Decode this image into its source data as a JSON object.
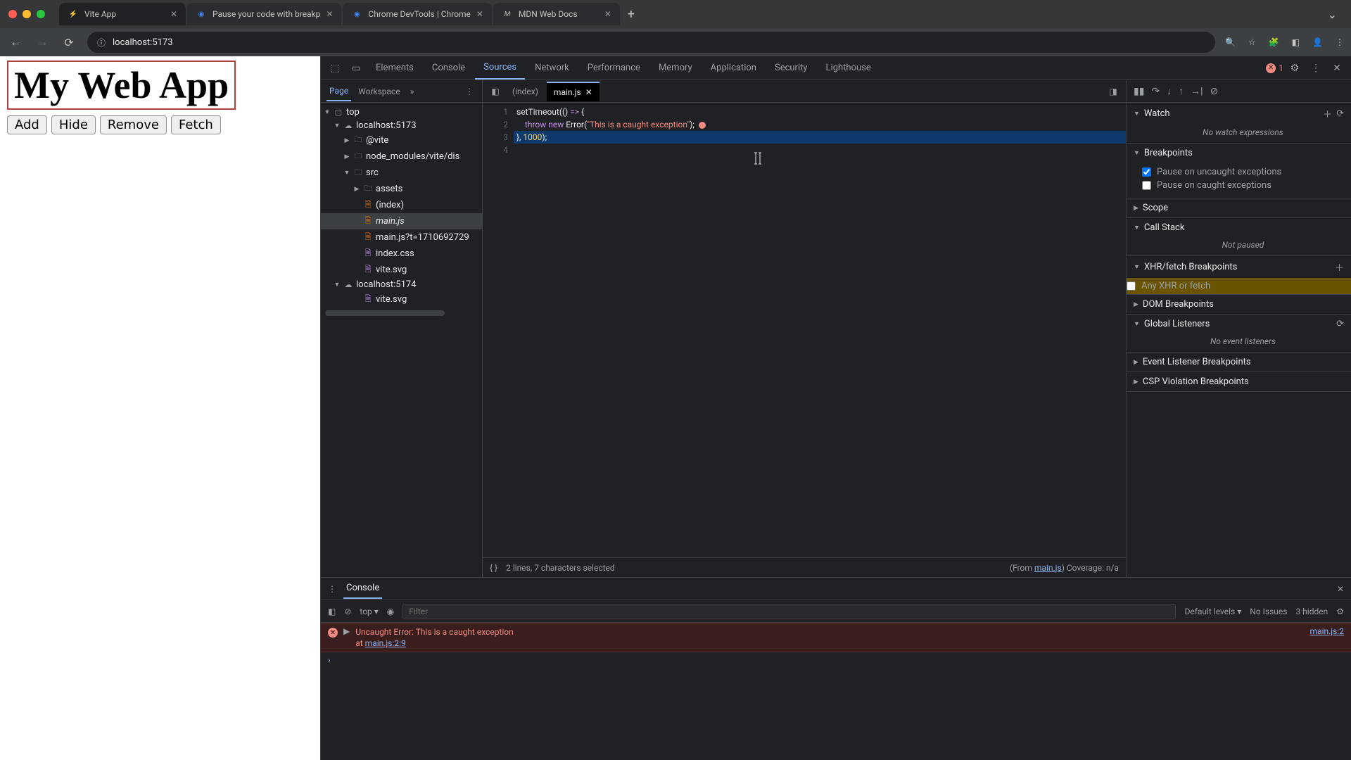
{
  "browser": {
    "tabs": [
      {
        "title": "Vite App",
        "favicon": "⚡"
      },
      {
        "title": "Pause your code with breakp",
        "favicon": "◉"
      },
      {
        "title": "Chrome DevTools  |  Chrome",
        "favicon": "◉"
      },
      {
        "title": "MDN Web Docs",
        "favicon": "M"
      }
    ],
    "url": "localhost:5173"
  },
  "page": {
    "heading": "My Web App",
    "buttons": [
      "Add",
      "Hide",
      "Remove",
      "Fetch"
    ]
  },
  "devtools": {
    "panels": [
      "Elements",
      "Console",
      "Sources",
      "Network",
      "Performance",
      "Memory",
      "Application",
      "Security",
      "Lighthouse"
    ],
    "active_panel": "Sources",
    "error_count": "1"
  },
  "nav": {
    "tabs": {
      "page": "Page",
      "workspace": "Workspace"
    },
    "tree": {
      "top": "top",
      "host1": "localhost:5173",
      "vite": "@vite",
      "node_modules": "node_modules/vite/dis",
      "src": "src",
      "assets": "assets",
      "index": "(index)",
      "mainjs": "main.js",
      "mainjs_q": "main.js?t=1710692729",
      "indexcss": "index.css",
      "vitesvg": "vite.svg",
      "host2": "localhost:5174",
      "vitesvg2": "vite.svg"
    }
  },
  "editor": {
    "tabs": {
      "index": "(index)",
      "main": "main.js"
    },
    "code": {
      "l1_a": "setTimeout",
      "l1_b": "(() ",
      "l1_c": "=>",
      "l1_d": " {",
      "l2_a": "    ",
      "l2_b": "throw new",
      "l2_c": " Error",
      "l2_d": "(",
      "l2_e": "\"This is a caught exception\"",
      "l2_f": ");",
      "l3_a": "}, ",
      "l3_b": "1000",
      "l3_c": ");"
    },
    "status_left": "2 lines, 7 characters selected",
    "status_from": "(From ",
    "status_link": "main.js",
    "status_cov": ") Coverage: n/a"
  },
  "dbg": {
    "watch": "Watch",
    "watch_empty": "No watch expressions",
    "breakpoints": "Breakpoints",
    "pause_uncaught": "Pause on uncaught exceptions",
    "pause_caught": "Pause on caught exceptions",
    "scope": "Scope",
    "callstack": "Call Stack",
    "not_paused": "Not paused",
    "xhr": "XHR/fetch Breakpoints",
    "any_xhr": "Any XHR or fetch",
    "dom_bp": "DOM Breakpoints",
    "global": "Global Listeners",
    "no_listeners": "No event listeners",
    "ev_bp": "Event Listener Breakpoints",
    "csp": "CSP Violation Breakpoints"
  },
  "console": {
    "tab": "Console",
    "context": "top",
    "filter_placeholder": "Filter",
    "levels": "Default levels",
    "no_issues": "No Issues",
    "hidden": "3 hidden",
    "error_msg": "Uncaught Error: This is a caught exception",
    "error_at": "    at ",
    "error_loc": "main.js:2:9",
    "error_src": "main.js:2"
  }
}
